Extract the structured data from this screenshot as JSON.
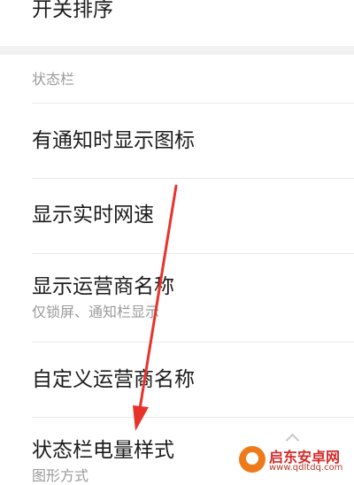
{
  "top_item": {
    "label": "开关排序"
  },
  "section": {
    "header": "状态栏"
  },
  "items": [
    {
      "label": "有通知时显示图标",
      "sub": ""
    },
    {
      "label": "显示实时网速",
      "sub": ""
    },
    {
      "label": "显示运营商名称",
      "sub": "仅锁屏、通知栏显示"
    },
    {
      "label": "自定义运营商名称",
      "sub": ""
    },
    {
      "label": "状态栏电量样式",
      "sub": "图形方式"
    }
  ],
  "watermark": {
    "name": "启东安卓网",
    "url": "www.qdltdq.com"
  },
  "colors": {
    "annotation_arrow": "#e8332b",
    "divider": "#e9e9e9",
    "section_gap": "#f2f2f2"
  }
}
